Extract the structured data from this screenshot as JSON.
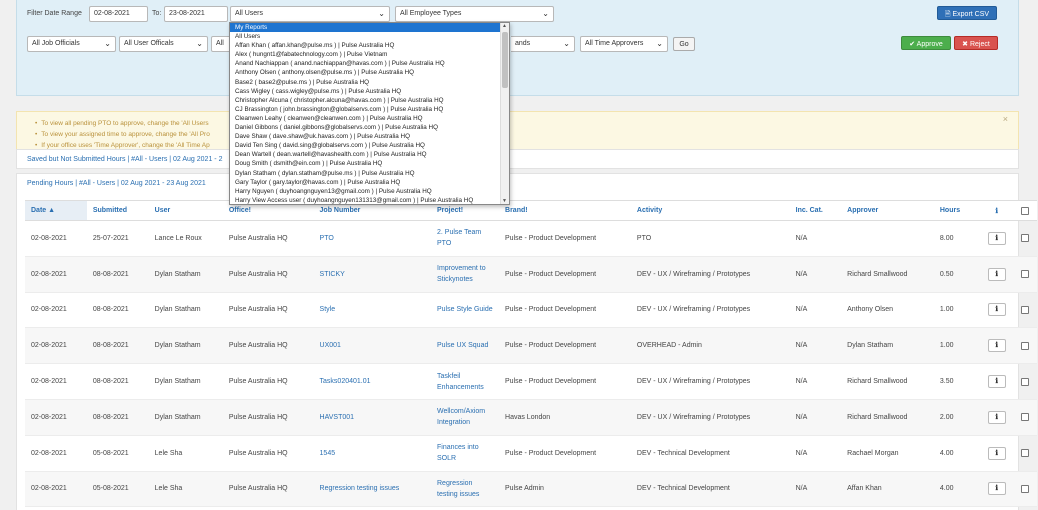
{
  "filters": {
    "date_range_label": "Filter Date Range",
    "date_from": "02-08-2021",
    "to_label": "To:",
    "date_to": "23-08-2021",
    "users_selected": "All Users",
    "employee_types_selected": "All Employee Types",
    "job_officials_selected": "All Job Officials",
    "user_officials_selected": "All User Officals",
    "third_select_visible": "All",
    "brands_select_visible": "ands",
    "time_approvers_selected": "All Time Approvers",
    "go_label": "Go",
    "export_label": "Export CSV",
    "approve_label": "✔ Approve",
    "reject_label": "✖ Reject"
  },
  "alert": {
    "lines": [
      "To view all pending PTO to approve, change the 'All Users",
      "To view your assigned time to approve, change the 'All Pro",
      "If your office uses 'Time Approver', change the 'All Time Ap"
    ],
    "close": "×"
  },
  "summaries": {
    "saved": "Saved but Not Submitted Hours | #All - Users | 02 Aug 2021 - 2",
    "pending": "Pending Hours | #All - Users | 02 Aug 2021 - 23 Aug 2021"
  },
  "table": {
    "headers": [
      "Date ▲",
      "Submitted",
      "User",
      "Office!",
      "Job Number",
      "Project!",
      "Brand!",
      "Activity",
      "Inc. Cat.",
      "Approver",
      "Hours",
      "ℹ",
      ""
    ],
    "rows": [
      {
        "date": "02-08-2021",
        "submitted": "25-07-2021",
        "user": "Lance Le Roux",
        "office": "Pulse Australia HQ",
        "job": "PTO",
        "project": "2. Pulse Team PTO",
        "brand": "Pulse - Product Development",
        "activity": "PTO",
        "inc": "N/A",
        "approver": "",
        "hours": "8.00"
      },
      {
        "date": "02-08-2021",
        "submitted": "08-08-2021",
        "user": "Dylan Statham",
        "office": "Pulse Australia HQ",
        "job": "STICKY",
        "project": "Improvement to Stickynotes",
        "brand": "Pulse - Product Development",
        "activity": "DEV - UX / Wireframing / Prototypes",
        "inc": "N/A",
        "approver": "Richard Smallwood",
        "hours": "0.50"
      },
      {
        "date": "02-08-2021",
        "submitted": "08-08-2021",
        "user": "Dylan Statham",
        "office": "Pulse Australia HQ",
        "job": "Style",
        "project": "Pulse Style Guide",
        "brand": "Pulse - Product Development",
        "activity": "DEV - UX / Wireframing / Prototypes",
        "inc": "N/A",
        "approver": "Anthony Olsen",
        "hours": "1.00"
      },
      {
        "date": "02-08-2021",
        "submitted": "08-08-2021",
        "user": "Dylan Statham",
        "office": "Pulse Australia HQ",
        "job": "UX001",
        "project": "Pulse UX Squad",
        "brand": "Pulse - Product Development",
        "activity": "OVERHEAD - Admin",
        "inc": "N/A",
        "approver": "Dylan Statham",
        "hours": "1.00"
      },
      {
        "date": "02-08-2021",
        "submitted": "08-08-2021",
        "user": "Dylan Statham",
        "office": "Pulse Australia HQ",
        "job": "Tasks020401.01",
        "project": "Taskfeil Enhancements",
        "brand": "Pulse - Product Development",
        "activity": "DEV - UX / Wireframing / Prototypes",
        "inc": "N/A",
        "approver": "Richard Smallwood",
        "hours": "3.50"
      },
      {
        "date": "02-08-2021",
        "submitted": "08-08-2021",
        "user": "Dylan Statham",
        "office": "Pulse Australia HQ",
        "job": "HAVST001",
        "project": "Wellcom/Axiom Integration",
        "brand": "Havas London",
        "activity": "DEV - UX / Wireframing / Prototypes",
        "inc": "N/A",
        "approver": "Richard Smallwood",
        "hours": "2.00"
      },
      {
        "date": "02-08-2021",
        "submitted": "05-08-2021",
        "user": "Lele Sha",
        "office": "Pulse Australia HQ",
        "job": "1545",
        "project": "Finances into SOLR",
        "brand": "Pulse - Product Development",
        "activity": "DEV - Technical Development",
        "inc": "N/A",
        "approver": "Rachael Morgan",
        "hours": "4.00"
      },
      {
        "date": "02-08-2021",
        "submitted": "05-08-2021",
        "user": "Lele Sha",
        "office": "Pulse Australia HQ",
        "job": "Regression testing issues",
        "project": "Regression testing issues",
        "brand": "Pulse Admin",
        "activity": "DEV - Technical Development",
        "inc": "N/A",
        "approver": "Affan Khan",
        "hours": "4.00"
      }
    ]
  },
  "user_dropdown": {
    "items": [
      "My Reports",
      "All Users",
      "Affan Khan ( affan.khan@pulse.ms ) | Pulse Australia HQ",
      "Alex ( hungnt1@fabatechnology.com ) | Pulse Vietnam",
      "Anand Nachiappan ( anand.nachiappan@havas.com ) | Pulse Australia HQ",
      "Anthony Olsen ( anthony.olsen@pulse.ms ) | Pulse Australia HQ",
      "Base2 ( base2@pulse.ms ) | Pulse Australia HQ",
      "Cass Wigley ( cass.wigley@pulse.ms ) | Pulse Australia HQ",
      "Christopher Alcuna ( christopher.alcuna@havas.com ) | Pulse Australia HQ",
      "CJ Brassington ( john.brassington@globalservs.com ) | Pulse Australia HQ",
      "Cleanwen Leahy ( cleanwen@cleanwen.com ) | Pulse Australia HQ",
      "Daniel Gibbons ( daniel.gibbons@globalservs.com ) | Pulse Australia HQ",
      "Dave Shaw ( dave.shaw@uk.havas.com ) | Pulse Australia HQ",
      "David Ten Sing ( david.sing@globalservs.com ) | Pulse Australia HQ",
      "Dean Wartell ( dean.wartell@havashealth.com ) | Pulse Australia HQ",
      "Doug Smith ( dsmith@ein.com ) | Pulse Australia HQ",
      "Dylan Statham ( dylan.statham@pulse.ms ) | Pulse Australia HQ",
      "Gary Taylor ( gary.taylor@havas.com ) | Pulse Australia HQ",
      "Harry Nguyen ( duyhoangnguyen13@gmail.com ) | Pulse Australia HQ",
      "Harry View Access user ( duyhoangnguyen131313@gmail.com ) | Pulse Australia HQ"
    ]
  }
}
